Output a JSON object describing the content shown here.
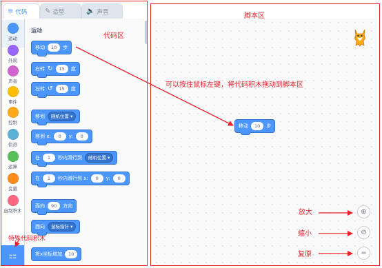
{
  "tabs": [
    {
      "label": "代码",
      "icon": "code-icon"
    },
    {
      "label": "造型",
      "icon": "brush-icon"
    },
    {
      "label": "声音",
      "icon": "speaker-icon"
    }
  ],
  "categories": [
    {
      "label": "运动",
      "color": "#4c97ff"
    },
    {
      "label": "外观",
      "color": "#9966ff"
    },
    {
      "label": "声音",
      "color": "#cf63cf"
    },
    {
      "label": "事件",
      "color": "#ffbf00"
    },
    {
      "label": "控制",
      "color": "#ffab19"
    },
    {
      "label": "侦测",
      "color": "#5cb1d6"
    },
    {
      "label": "运算",
      "color": "#59c059"
    },
    {
      "label": "变量",
      "color": "#ff8c1a"
    },
    {
      "label": "自制积木",
      "color": "#ff6680"
    }
  ],
  "palette": {
    "section_title": "运动",
    "blocks": {
      "move": {
        "text1": "移动",
        "value": "10",
        "text2": "步"
      },
      "turn_right": {
        "text1": "右转",
        "value": "15",
        "text2": "度"
      },
      "turn_left": {
        "text1": "左转",
        "value": "15",
        "text2": "度"
      },
      "goto": {
        "text1": "移到",
        "dropdown": "随机位置"
      },
      "goto_xy": {
        "text1": "移到 x:",
        "x": "0",
        "text2": "y:",
        "y": "0"
      },
      "glide": {
        "text1": "在",
        "secs": "1",
        "text2": "秒内滑行到",
        "dropdown": "随机位置"
      },
      "glide_xy": {
        "text1": "在",
        "secs": "1",
        "text2": "秒内滑行到 x:",
        "x": "0",
        "text3": "y:",
        "y": "0"
      },
      "point_dir": {
        "text1": "面向",
        "value": "90",
        "text2": "方向"
      },
      "point_towards": {
        "text1": "面向",
        "dropdown": "鼠标指针"
      },
      "change_x": {
        "text1": "将x坐标增加",
        "value": "10"
      }
    }
  },
  "script": {
    "block": {
      "text1": "移动",
      "value": "10",
      "text2": "步"
    }
  },
  "annotations": {
    "code_area": "代码区",
    "script_area": "脚本区",
    "drag_hint": "可以按住鼠标左键，将代码积木拖动到脚本区",
    "zoom_in": "放大",
    "zoom_out": "缩小",
    "reset": "复原",
    "special_blocks": "特殊代码积木"
  },
  "zoom_controls": {
    "zoom_in_icon": "⊕",
    "zoom_out_icon": "⊖",
    "reset_icon": "="
  },
  "colors": {
    "accent": "#4c97ff",
    "annotation": "#e8212b"
  }
}
